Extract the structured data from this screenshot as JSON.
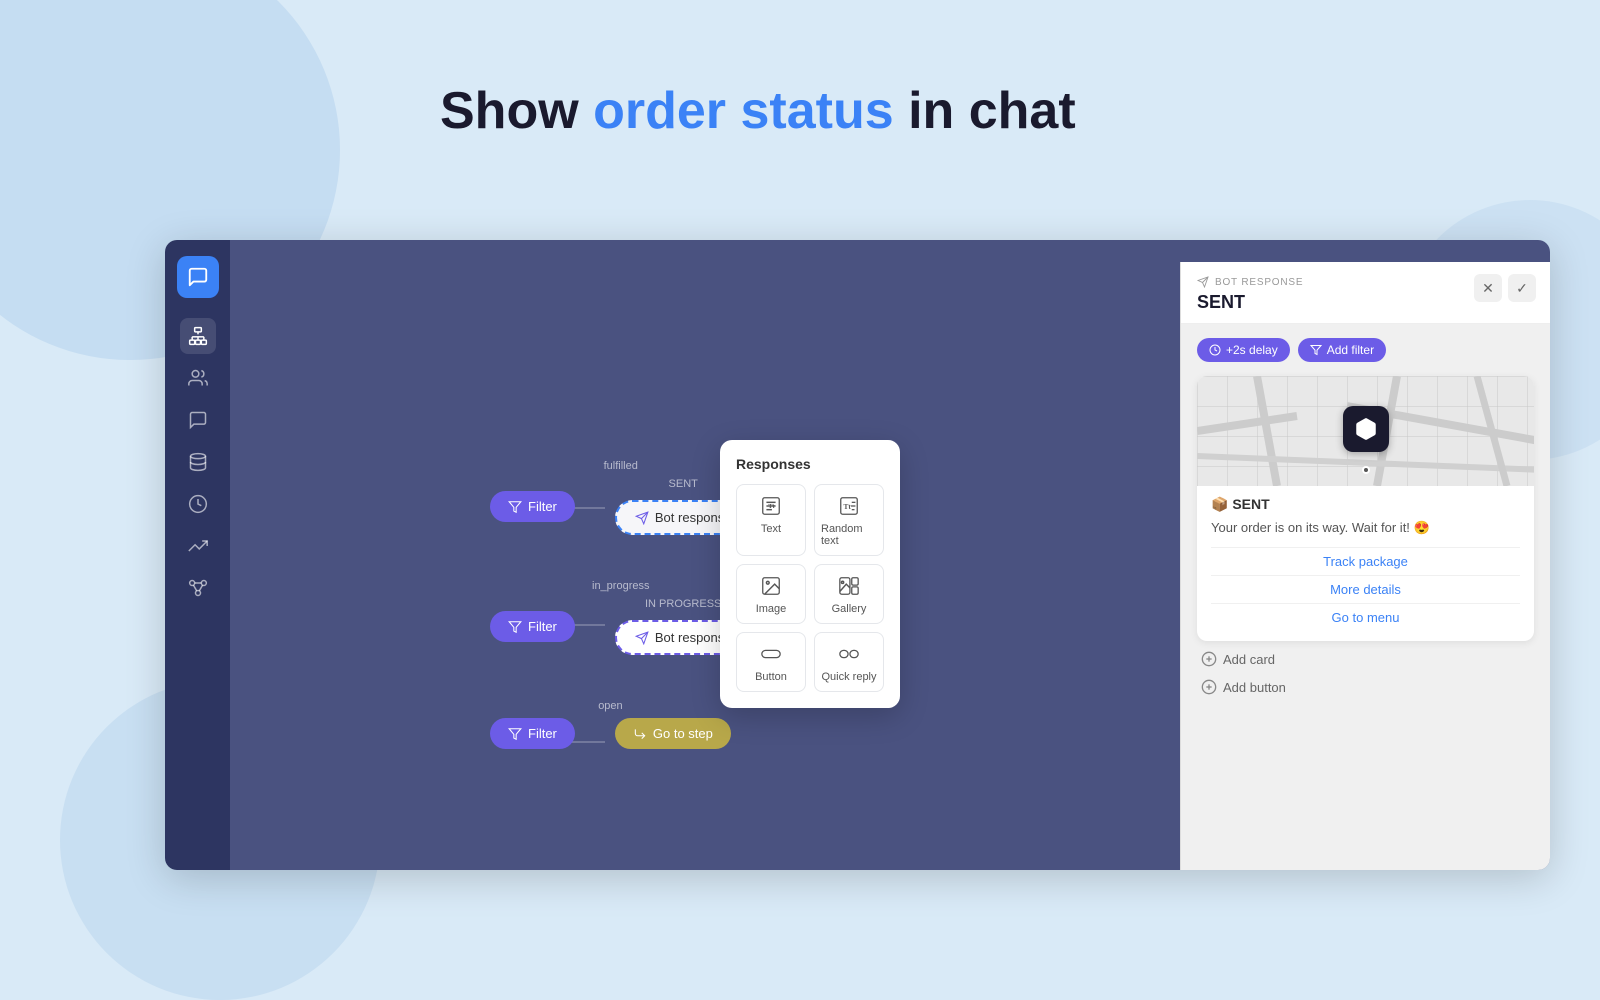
{
  "page": {
    "title_prefix": "Show ",
    "title_highlight": "order status",
    "title_suffix": " in chat"
  },
  "sidebar": {
    "items": [
      {
        "name": "chat-icon",
        "label": "Chat"
      },
      {
        "name": "org-chart-icon",
        "label": "Organization"
      },
      {
        "name": "users-icon",
        "label": "Users"
      },
      {
        "name": "comments-icon",
        "label": "Comments"
      },
      {
        "name": "database-icon",
        "label": "Database"
      },
      {
        "name": "analytics-icon",
        "label": "Analytics"
      },
      {
        "name": "trending-icon",
        "label": "Trending"
      },
      {
        "name": "integrations-icon",
        "label": "Integrations"
      }
    ]
  },
  "responses_modal": {
    "title": "Responses",
    "items": [
      {
        "label": "Text",
        "icon": "text-icon"
      },
      {
        "label": "Random text",
        "icon": "random-text-icon"
      },
      {
        "label": "Image",
        "icon": "image-icon"
      },
      {
        "label": "Gallery",
        "icon": "gallery-icon"
      },
      {
        "label": "Button",
        "icon": "button-icon"
      },
      {
        "label": "Quick reply",
        "icon": "quick-reply-icon"
      }
    ]
  },
  "bot_panel": {
    "label": "BOT RESPONSE",
    "title": "SENT",
    "delay_tag": "+2s delay",
    "filter_tag": "Add filter",
    "card": {
      "emoji": "📦",
      "title": "📦 SENT",
      "message": "Your order is on its way. Wait for it! 😍",
      "links": [
        {
          "text": "Track package"
        },
        {
          "text": "More details"
        },
        {
          "text": "Go to menu"
        }
      ]
    },
    "add_card_label": "Add card",
    "add_button_label": "Add button"
  },
  "flow": {
    "fulfilled": {
      "label": "fulfilled",
      "filter_btn": "Filter",
      "bot_label": "SENT",
      "bot_btn": "Bot response"
    },
    "in_progress": {
      "label": "in_progress",
      "filter_btn": "Filter",
      "bot_label": "IN PROGRESS",
      "bot_btn": "Bot response"
    },
    "open": {
      "label": "open",
      "filter_btn": "Filter",
      "goto_btn": "Go to step"
    }
  }
}
